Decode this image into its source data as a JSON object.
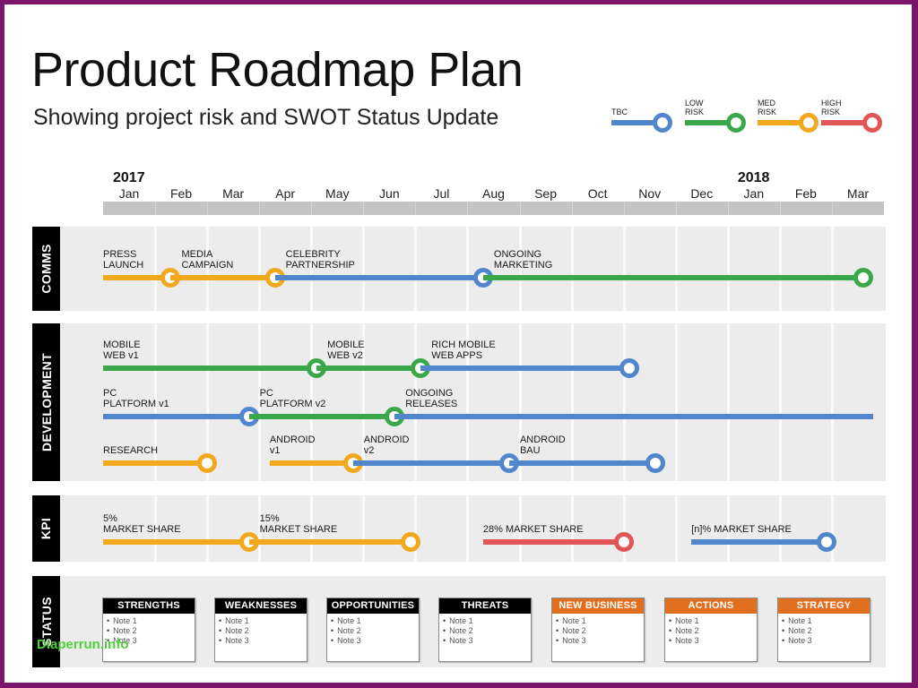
{
  "title": "Product Roadmap Plan",
  "subtitle": "Showing project risk and SWOT Status Update",
  "colors": {
    "tbc": "#4f86cc",
    "low": "#3aa84a",
    "med": "#f2a81d",
    "high": "#e05555",
    "orange_header": "#e0701f",
    "black_header": "#000000",
    "frame": "#7a1569"
  },
  "legend": [
    {
      "label": "TBC",
      "risk": "tbc"
    },
    {
      "label": "LOW\nRISK",
      "risk": "low"
    },
    {
      "label": "MED\nRISK",
      "risk": "med"
    },
    {
      "label": "HIGH\nRISK",
      "risk": "high"
    }
  ],
  "timeline": {
    "years": [
      {
        "label": "2017",
        "month_index": 0
      },
      {
        "label": "2018",
        "month_index": 12
      }
    ],
    "months": [
      "Jan",
      "Feb",
      "Mar",
      "Apr",
      "May",
      "Jun",
      "Jul",
      "Aug",
      "Sep",
      "Oct",
      "Nov",
      "Dec",
      "Jan",
      "Feb",
      "Mar"
    ]
  },
  "bands": [
    {
      "label": "COMMS",
      "tracks": [
        {
          "start": 0,
          "segments": [
            {
              "label": "PRESS\nLAUNCH",
              "end": 1.3,
              "risk": "med"
            },
            {
              "label": "MEDIA\nCAMPAIGN",
              "end": 3.3,
              "risk": "med"
            },
            {
              "label": "CELEBRITY\nPARTNERSHIP",
              "end": 7.3,
              "risk": "tbc"
            },
            {
              "label": "ONGOING\nMARKETING",
              "end": 14.6,
              "risk": "low"
            }
          ]
        }
      ]
    },
    {
      "label": "DEVELOPMENT",
      "tracks": [
        {
          "start": 0,
          "segments": [
            {
              "label": "MOBILE\nWEB v1",
              "end": 4.1,
              "risk": "low"
            },
            {
              "label": "MOBILE\nWEB v2",
              "end": 6.1,
              "risk": "low"
            },
            {
              "label": "RICH MOBILE\nWEB APPS",
              "end": 10.1,
              "risk": "tbc"
            }
          ]
        },
        {
          "start": 0,
          "segments": [
            {
              "label": "PC\nPLATFORM v1",
              "end": 2.8,
              "risk": "tbc"
            },
            {
              "label": "PC\nPLATFORM v2",
              "end": 5.6,
              "risk": "low"
            },
            {
              "label": "ONGOING\nRELEASES",
              "end": 14.8,
              "risk": "tbc",
              "open_end": true
            }
          ]
        },
        {
          "start": 0,
          "segments": [
            {
              "label": "RESEARCH",
              "end": 2.0,
              "risk": "med"
            },
            {
              "label": "ANDROID\nv1",
              "start": 3.2,
              "end": 4.8,
              "risk": "med"
            },
            {
              "label": "ANDROID\nv2",
              "end": 7.8,
              "risk": "tbc"
            },
            {
              "label": "ANDROID\nBAU",
              "end": 10.6,
              "risk": "tbc"
            }
          ]
        }
      ]
    },
    {
      "label": "KPI",
      "tracks": [
        {
          "start": 0,
          "segments": [
            {
              "label": "5%\nMARKET SHARE",
              "end": 2.8,
              "risk": "med"
            },
            {
              "label": "15%\nMARKET SHARE",
              "end": 5.9,
              "risk": "med"
            },
            {
              "label": "28% MARKET SHARE",
              "start": 7.3,
              "end": 10.0,
              "risk": "high"
            },
            {
              "label": "[n]% MARKET SHARE",
              "start": 11.3,
              "end": 13.9,
              "risk": "tbc"
            }
          ]
        }
      ]
    }
  ],
  "status": {
    "label": "STATUS",
    "boxes": [
      {
        "title": "STRENGTHS",
        "header": "black",
        "notes": [
          "Note 1",
          "Note 2",
          "Note 3"
        ]
      },
      {
        "title": "WEAKNESSES",
        "header": "black",
        "notes": [
          "Note 1",
          "Note 2",
          "Note 3"
        ]
      },
      {
        "title": "OPPORTUNITIES",
        "header": "black",
        "notes": [
          "Note 1",
          "Note 2",
          "Note 3"
        ]
      },
      {
        "title": "THREATS",
        "header": "black",
        "notes": [
          "Note 1",
          "Note 2",
          "Note 3"
        ]
      },
      {
        "title": "NEW BUSINESS",
        "header": "orange",
        "notes": [
          "Note 1",
          "Note 2",
          "Note 3"
        ]
      },
      {
        "title": "ACTIONS",
        "header": "orange",
        "notes": [
          "Note 1",
          "Note 2",
          "Note 3"
        ]
      },
      {
        "title": "STRATEGY",
        "header": "orange",
        "notes": [
          "Note 1",
          "Note 2",
          "Note 3"
        ]
      }
    ]
  },
  "watermark": "Diaperrun.info"
}
